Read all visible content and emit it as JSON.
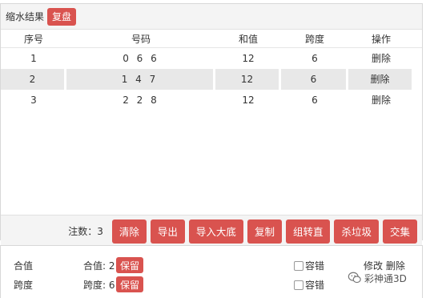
{
  "panel": {
    "title": "缩水结果",
    "review_button": "复盘"
  },
  "table": {
    "headers": [
      "序号",
      "号码",
      "和值",
      "跨度",
      "操作"
    ],
    "rows": [
      {
        "index": "1",
        "number": "0 6 6",
        "sum": "12",
        "span": "6",
        "action": "删除"
      },
      {
        "index": "2",
        "number": "1 4 7",
        "sum": "12",
        "span": "6",
        "action": "删除"
      },
      {
        "index": "3",
        "number": "2 2 8",
        "sum": "12",
        "span": "6",
        "action": "删除"
      }
    ]
  },
  "footer": {
    "count_text": "注数：3",
    "buttons": [
      "清除",
      "导出",
      "导入大底",
      "复制",
      "组转直",
      "杀垃圾",
      "交集"
    ]
  },
  "conditions": [
    {
      "label": "合值",
      "value": "合值: 2",
      "keep": "保留",
      "tolerance": "容错",
      "actions": "修改 删除"
    },
    {
      "label": "跨度",
      "value": "跨度: 6",
      "keep": "保留",
      "tolerance": "容错",
      "actions": ""
    }
  ],
  "watermark": {
    "text": "彩神通3D"
  },
  "colors": {
    "accent": "#d9534f",
    "row_highlight": "#e8e8e8",
    "header_bg": "#f4f4f4"
  }
}
